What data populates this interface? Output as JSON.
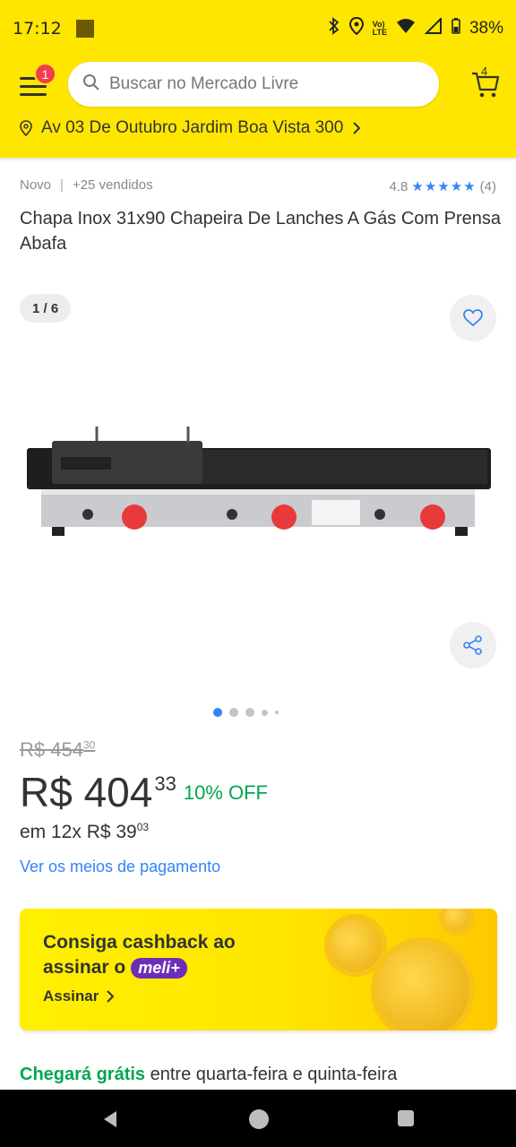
{
  "status_bar": {
    "time": "17:12",
    "battery": "38%"
  },
  "header": {
    "menu_badge": "1",
    "search_placeholder": "Buscar no Mercado Livre",
    "cart_count": "4",
    "address": "Av 03 De Outubro Jardim Boa Vista 300"
  },
  "product": {
    "condition": "Novo",
    "sold": "+25 vendidos",
    "rating": "4.8",
    "stars": "★★★★★",
    "reviews": "(4)",
    "title": "Chapa Inox 31x90 Chapeira De Lanches A Gás Com Prensa Abafa",
    "image_counter": "1 / 6",
    "old_price_main": "R$ 454",
    "old_price_cents": "30",
    "price_main": "R$ 404",
    "price_cents": "33",
    "discount": "10% OFF",
    "installment_main": "em 12x R$ 39",
    "installment_cents": "03",
    "payment_link": "Ver os meios de pagamento"
  },
  "promo": {
    "line1": "Consiga cashback ao",
    "line2": "assinar o",
    "brand": "meli+",
    "cta": "Assinar"
  },
  "delivery": {
    "free": "Chegará grátis",
    "window": "entre quarta-feira e quinta-feira"
  },
  "colors": {
    "brand_yellow": "#ffe600",
    "accent_blue": "#3483fa",
    "discount_green": "#00a650",
    "badge_red": "#f23d4f"
  }
}
